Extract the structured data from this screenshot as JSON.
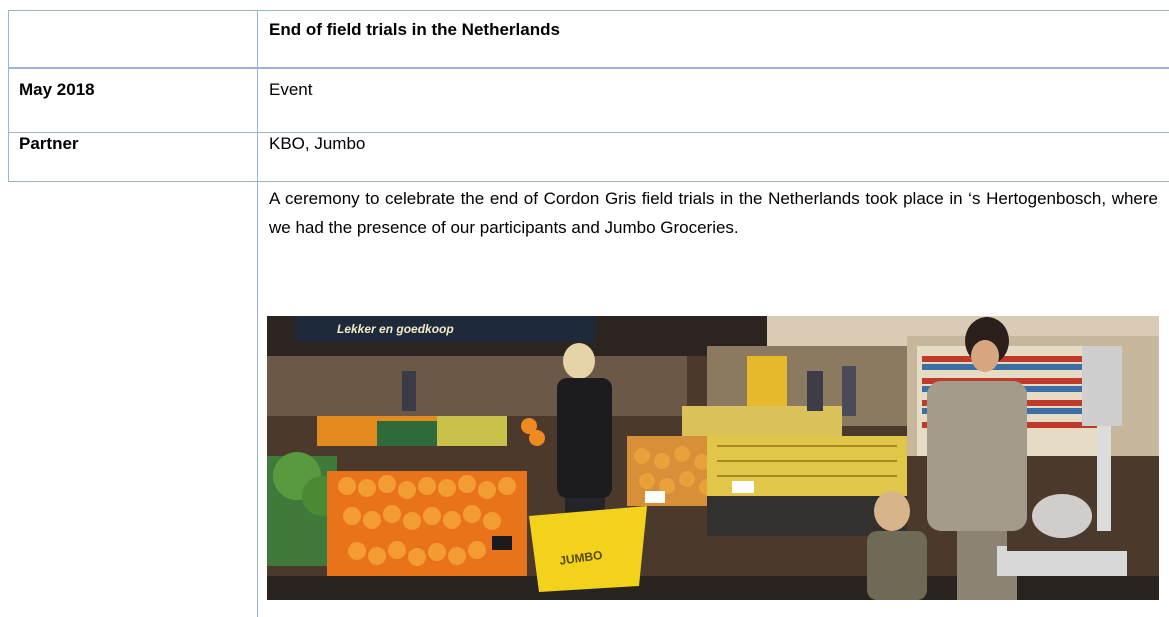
{
  "header": {
    "title": "End of field trials in the Netherlands"
  },
  "rows": [
    {
      "label": "May 2018",
      "value": "Event"
    },
    {
      "label": "Partner",
      "value": "KBO, Jumbo"
    }
  ],
  "description": "A ceremony to celebrate the end of Cordon Gris field trials in the Netherlands took place in ‘s Hertogenbosch, where we had the presence of our participants and Jumbo Groceries.",
  "photo": {
    "store_sign": "Lekker en goedkoop",
    "basket_label": "JUMBO"
  }
}
